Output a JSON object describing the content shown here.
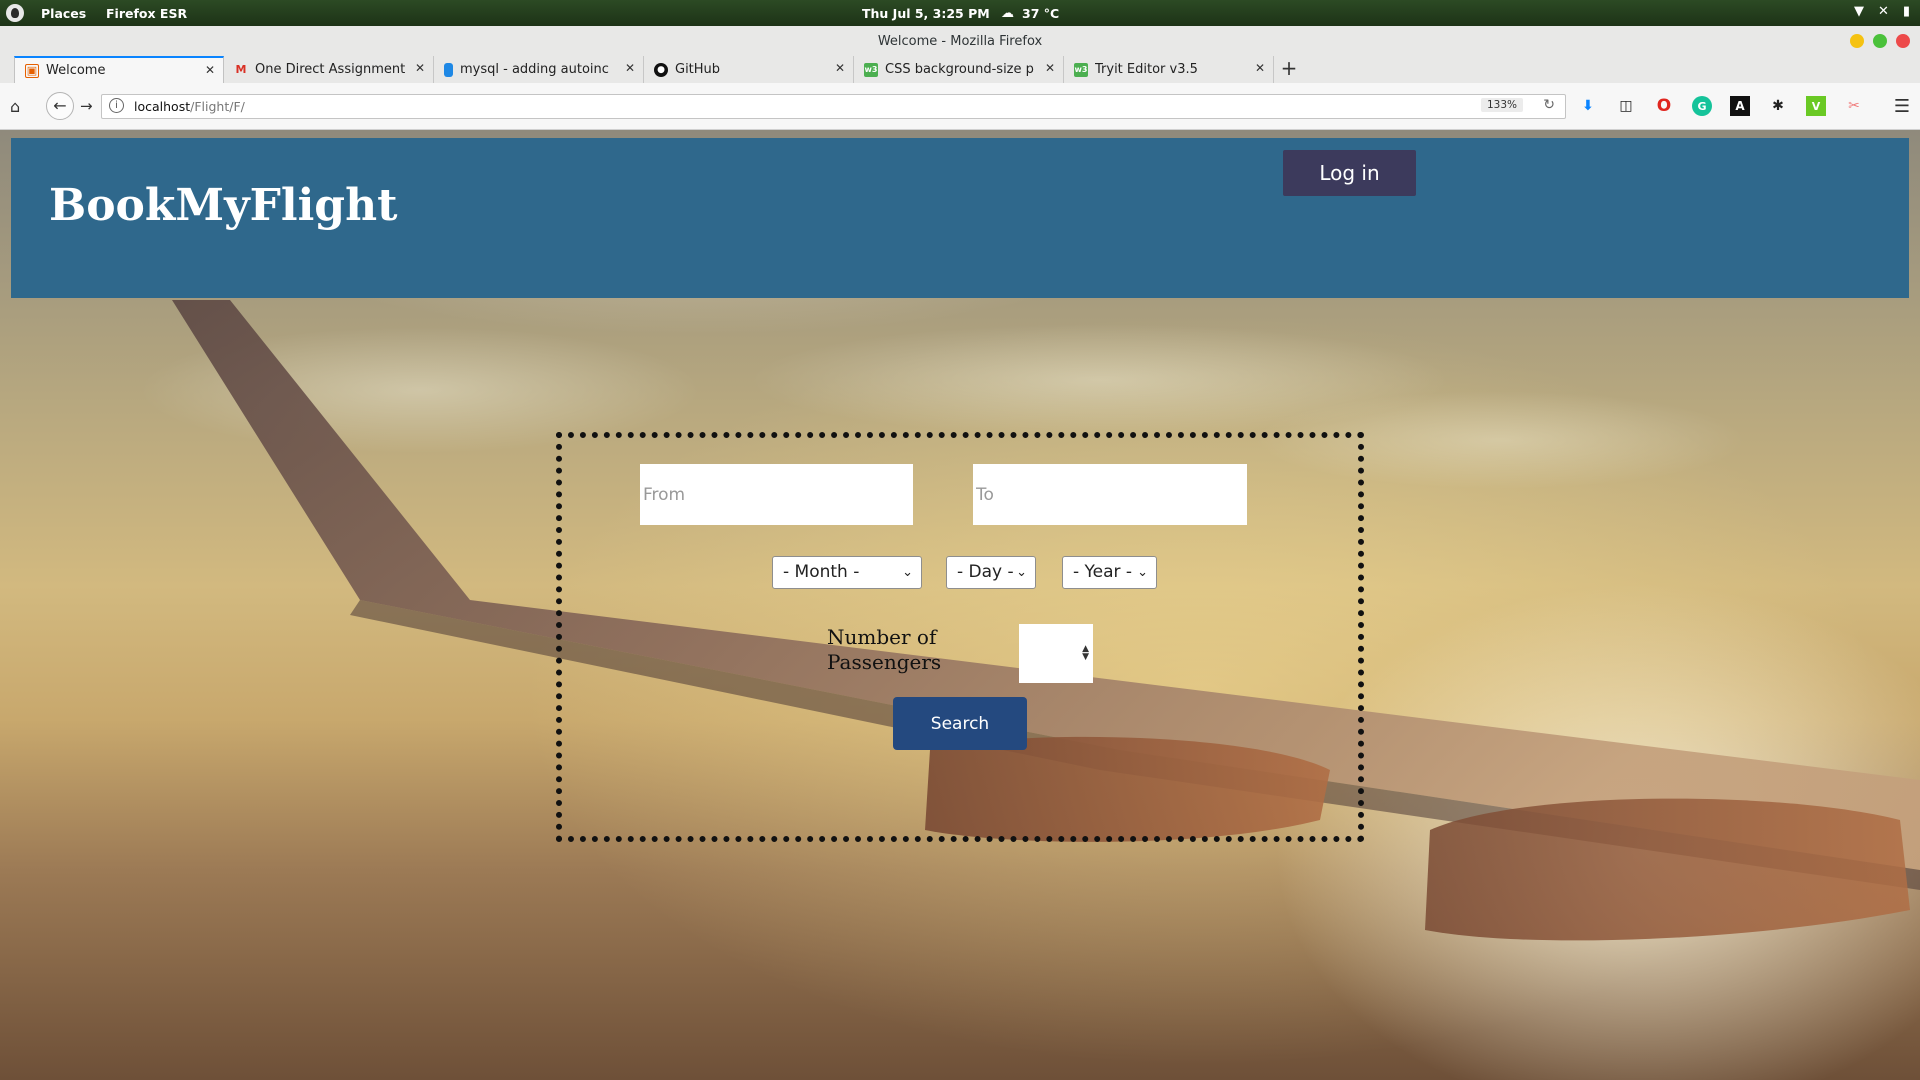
{
  "system": {
    "places": "Places",
    "app": "Firefox ESR",
    "clock": "Thu Jul  5,  3:25 PM",
    "weather": "37 °C"
  },
  "window": {
    "title": "Welcome - Mozilla Firefox"
  },
  "tabs": [
    {
      "label": "Welcome",
      "favicon": "page-icon",
      "favicon_color": "#e66000"
    },
    {
      "label": "One Direct Assignment t...",
      "favicon": "gmail-icon",
      "favicon_color": "#d93025"
    },
    {
      "label": "mysql - adding autoincre...",
      "favicon": "db-icon",
      "favicon_color": "#1e88e5"
    },
    {
      "label": "GitHub",
      "favicon": "github-icon",
      "favicon_color": "#111111"
    },
    {
      "label": "CSS background-size pro...",
      "favicon": "w3-icon",
      "favicon_color": "#4caf50"
    },
    {
      "label": "Tryit Editor v3.5",
      "favicon": "w3-icon",
      "favicon_color": "#4caf50"
    }
  ],
  "navbar": {
    "url_host": "localhost",
    "url_path": "/Flight/F/",
    "zoom": "133%"
  },
  "page": {
    "brand": "BookMyFlight",
    "login_label": "Log in",
    "search": {
      "from_placeholder": "From",
      "to_placeholder": "To",
      "month_label": "- Month -",
      "day_label": "- Day -",
      "year_label": "- Year -",
      "passengers_label": "Number of Passengers",
      "search_label": "Search"
    }
  },
  "colors": {
    "header_bg": "#2f688c",
    "login_bg": "#3c3a5c",
    "search_btn_bg": "#24497f"
  }
}
